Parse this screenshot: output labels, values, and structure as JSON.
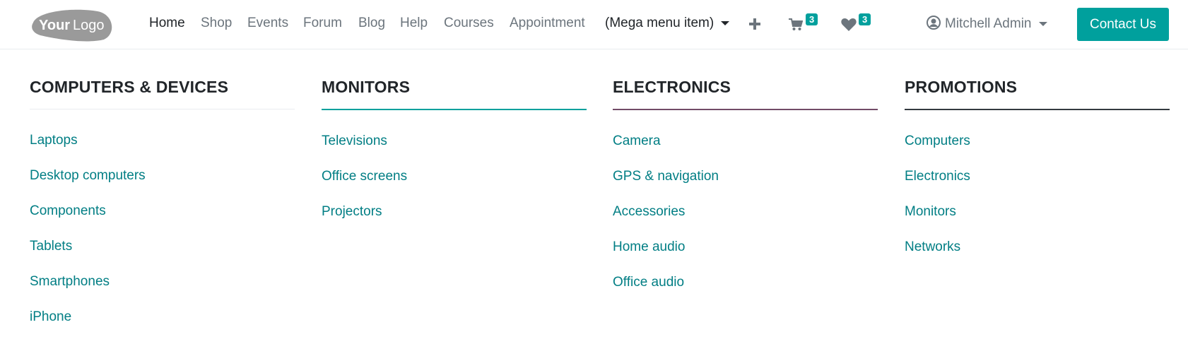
{
  "header": {
    "logo_text": "YourLogo",
    "nav": [
      {
        "label": "Home",
        "active": true
      },
      {
        "label": "Shop"
      },
      {
        "label": "Events"
      },
      {
        "label": "Forum"
      },
      {
        "label": "Blog"
      },
      {
        "label": "Help"
      },
      {
        "label": "Courses"
      },
      {
        "label": "Appointment"
      },
      {
        "label": "(Mega menu item)"
      }
    ],
    "cart_count": "3",
    "wishlist_count": "3",
    "user_name": "Mitchell Admin",
    "contact_label": "Contact Us"
  },
  "colors": {
    "accent": "#00a09d",
    "link": "#017e84",
    "plum": "#714b67",
    "dark": "#343a40"
  },
  "mega_menu": {
    "columns": [
      {
        "title": "COMPUTERS & DEVICES",
        "items": [
          "Laptops",
          "Desktop computers",
          "Components",
          "Tablets",
          "Smartphones",
          "iPhone"
        ]
      },
      {
        "title": "MONITORS",
        "items": [
          "Televisions",
          "Office screens",
          "Projectors"
        ]
      },
      {
        "title": "ELECTRONICS",
        "items": [
          "Camera",
          "GPS & navigation",
          "Accessories",
          "Home audio",
          "Office audio"
        ]
      },
      {
        "title": "PROMOTIONS",
        "items": [
          "Computers",
          "Electronics",
          "Monitors",
          "Networks"
        ]
      }
    ]
  }
}
